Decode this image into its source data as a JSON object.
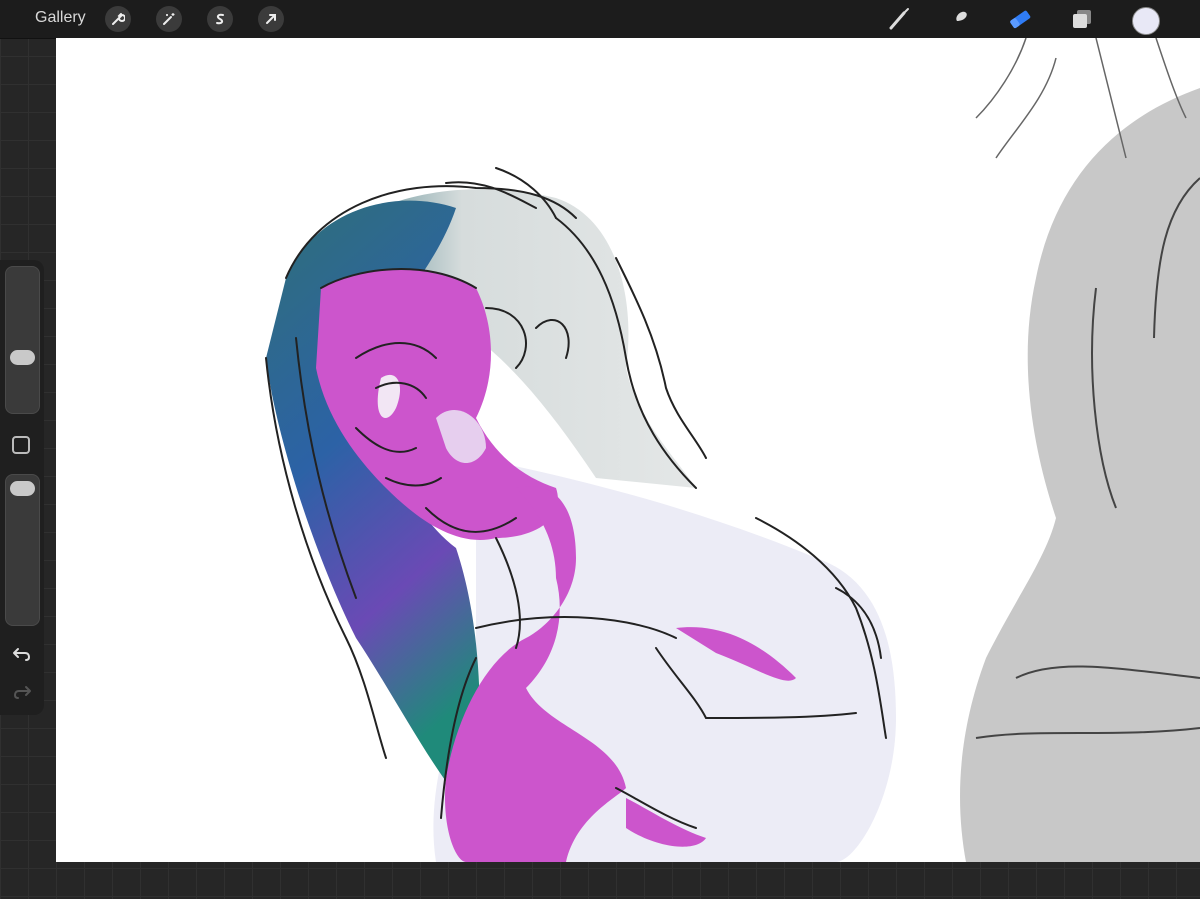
{
  "topbar": {
    "gallery_label": "Gallery",
    "left_tools": [
      "wrench-icon",
      "magic-wand-icon",
      "selection-icon",
      "transform-arrow-icon"
    ],
    "right_tools": [
      "brush-icon",
      "smudge-icon",
      "eraser-icon",
      "layers-icon"
    ],
    "active_tool": "eraser",
    "current_color": "#e8e8f6"
  },
  "sidebar": {
    "brush_size_level": 0.25,
    "opacity_level": 0.05
  },
  "colors": {
    "accent": "#2f7cf6",
    "skin": "#cc55cc",
    "hair_teal": "#2f6f78",
    "hair_blue": "#3a4ab5",
    "body": "#ececf6",
    "sketch_gray": "#c8c8c8"
  }
}
